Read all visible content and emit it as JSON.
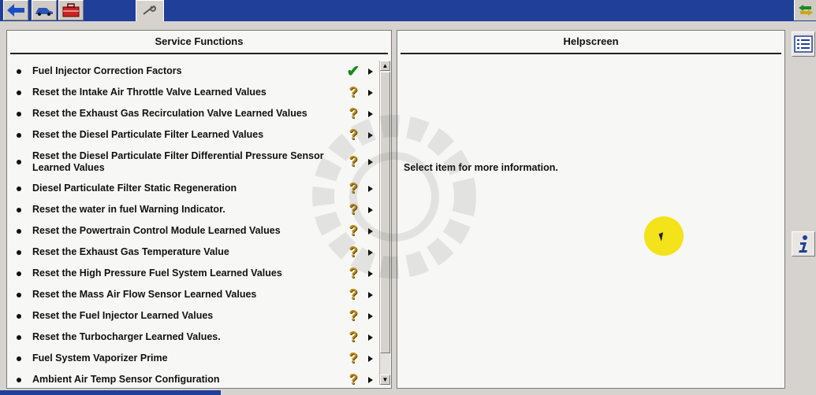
{
  "toolbar": {
    "buttons": [
      {
        "icon": "back-arrow-icon"
      },
      {
        "icon": "vehicle-icon"
      },
      {
        "icon": "toolbox-icon"
      }
    ],
    "active_tab_icon": "wrench-icon",
    "right_icon": "swap-arrows-icon"
  },
  "left_panel": {
    "title": "Service Functions",
    "items": [
      {
        "label": "Fuel Injector Correction Factors",
        "status": "check"
      },
      {
        "label": "Reset the Intake Air Throttle Valve Learned Values",
        "status": "question"
      },
      {
        "label": "Reset the Exhaust Gas Recirculation Valve Learned Values",
        "status": "question"
      },
      {
        "label": "Reset the Diesel Particulate Filter Learned Values",
        "status": "question"
      },
      {
        "label": "Reset the Diesel Particulate Filter Differential Pressure Sensor Learned Values",
        "status": "question"
      },
      {
        "label": "Diesel Particulate Filter Static Regeneration",
        "status": "question"
      },
      {
        "label": "Reset the water in fuel Warning Indicator.",
        "status": "question"
      },
      {
        "label": "Reset the Powertrain Control Module Learned Values",
        "status": "question"
      },
      {
        "label": "Reset the Exhaust Gas Temperature Value",
        "status": "question"
      },
      {
        "label": "Reset the High Pressure Fuel System Learned Values",
        "status": "question"
      },
      {
        "label": "Reset the Mass Air Flow Sensor Learned Values",
        "status": "question"
      },
      {
        "label": "Reset the Fuel Injector Learned Values",
        "status": "question"
      },
      {
        "label": "Reset the Turbocharger Learned Values.",
        "status": "question"
      },
      {
        "label": "Fuel System Vaporizer Prime",
        "status": "question"
      },
      {
        "label": "Ambient Air Temp Sensor Configuration",
        "status": "question"
      }
    ]
  },
  "right_panel": {
    "title": "Helpscreen",
    "message": "Select item for more information."
  },
  "side_buttons": [
    {
      "icon": "list-icon"
    },
    {
      "icon": "info-icon"
    }
  ],
  "colors": {
    "title_bar": "#1f3f98",
    "check": "#1a8a1a",
    "question": "#c08a12"
  }
}
